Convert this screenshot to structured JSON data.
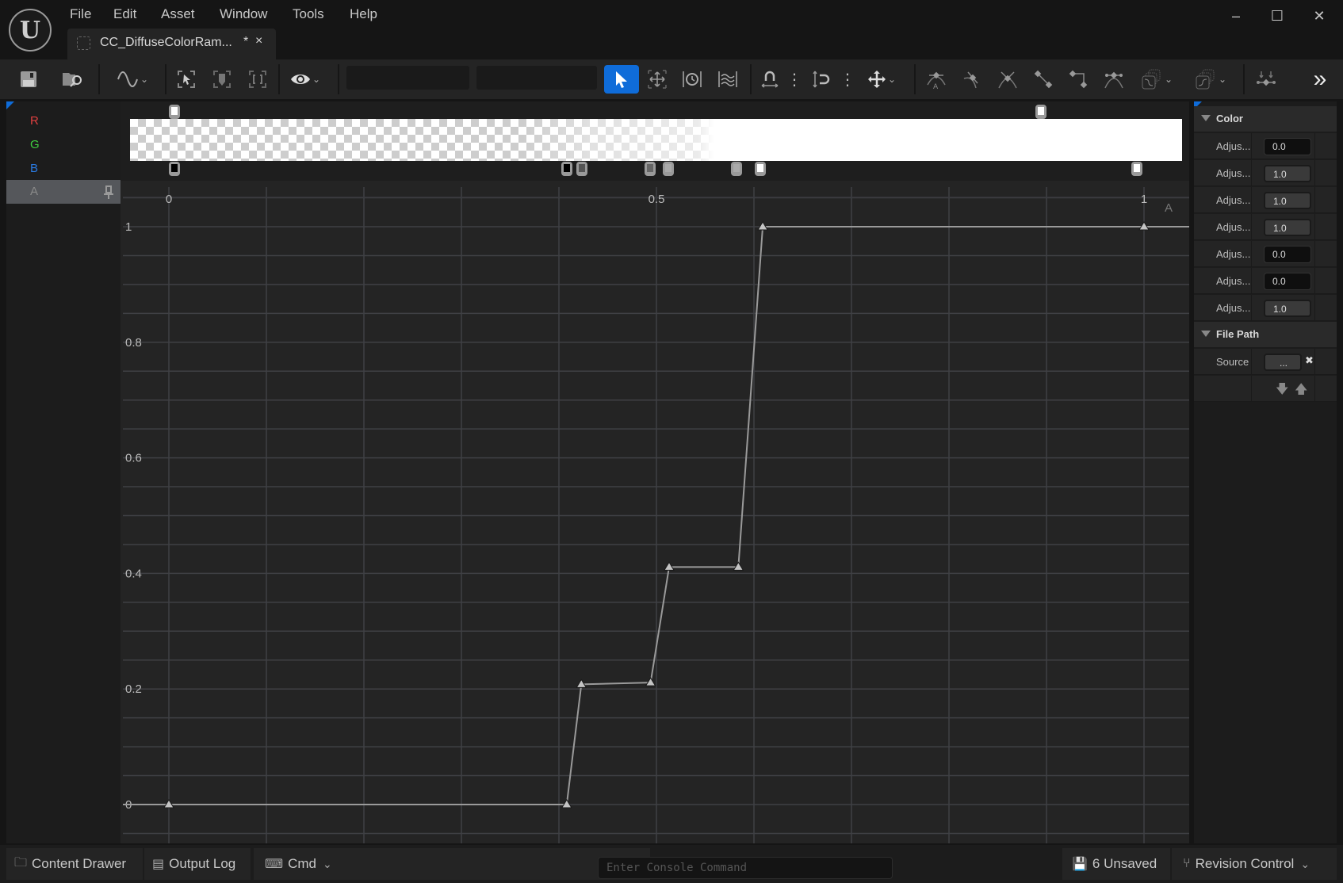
{
  "app": {
    "logo": "unreal-engine-logo",
    "menu": [
      "File",
      "Edit",
      "Asset",
      "Window",
      "Tools",
      "Help"
    ],
    "tab": {
      "label": "CC_DiffuseColorRam...",
      "modified": "*",
      "close": "×"
    },
    "window_controls": {
      "minimize": "–",
      "maximize": "☐",
      "close": "✕"
    }
  },
  "toolbar": {
    "items": [
      {
        "name": "save-icon",
        "glyph": "💾"
      },
      {
        "name": "browse-asset-icon",
        "glyph": "🗀"
      },
      {
        "name": "curve-view-icon",
        "glyph": "∿"
      },
      {
        "name": "frame-selection-icon",
        "glyph": "⬚"
      },
      {
        "name": "frame-pin-icon",
        "glyph": "⬚"
      },
      {
        "name": "frame-all-icon",
        "glyph": "⬚"
      },
      {
        "name": "visibility-eye-icon",
        "glyph": "👁"
      },
      {
        "name": "select-tool-icon",
        "glyph": "➤"
      },
      {
        "name": "transform-tool-icon",
        "glyph": "✥"
      },
      {
        "name": "retime-tool-icon",
        "glyph": "◷"
      },
      {
        "name": "multi-scale-tool-icon",
        "glyph": "≋"
      },
      {
        "name": "snap-time-icon",
        "glyph": "⏚"
      },
      {
        "name": "snap-value-icon",
        "glyph": "⊐"
      },
      {
        "name": "axis-snap-icon",
        "glyph": "✥"
      },
      {
        "name": "tangent-auto-icon",
        "glyph": "⌒"
      },
      {
        "name": "tangent-user-icon",
        "glyph": "⌒"
      },
      {
        "name": "tangent-break-icon",
        "glyph": "⋎"
      },
      {
        "name": "interp-linear-icon",
        "glyph": "⟍"
      },
      {
        "name": "interp-constant-icon",
        "glyph": "⌐"
      },
      {
        "name": "tangent-weighted-icon",
        "glyph": "⌒"
      },
      {
        "name": "pre-infinity-icon",
        "glyph": "⧉"
      },
      {
        "name": "post-infinity-icon",
        "glyph": "⧉"
      },
      {
        "name": "flatten-tangents-icon",
        "glyph": "⋯"
      },
      {
        "name": "more-icon",
        "glyph": "»"
      }
    ],
    "active_tool": "select-tool-icon"
  },
  "channels": [
    {
      "label": "R",
      "color": "#e04040"
    },
    {
      "label": "G",
      "color": "#3fcf3f"
    },
    {
      "label": "B",
      "color": "#2a7ae0"
    },
    {
      "label": "A",
      "color": "#8a8a8a",
      "selected": true
    }
  ],
  "gradient": {
    "alpha_stops_top": [
      0.0,
      0.9
    ],
    "color_stops_bottom": [
      {
        "pos": 0.0,
        "value": "#000000"
      },
      {
        "pos": 0.408,
        "value": "#000000"
      },
      {
        "pos": 0.423,
        "value": "#555555"
      },
      {
        "pos": 0.494,
        "value": "#666666"
      },
      {
        "pos": 0.513,
        "value": "#aaaaaa"
      },
      {
        "pos": 0.584,
        "value": "#aaaaaa"
      },
      {
        "pos": 0.609,
        "value": "#ffffff"
      },
      {
        "pos": 1.0,
        "value": "#ffffff"
      }
    ]
  },
  "chart_data": {
    "type": "line",
    "title": "",
    "series": [
      {
        "name": "A",
        "x": [
          0.0,
          0.408,
          0.423,
          0.494,
          0.513,
          0.584,
          0.609,
          1.0
        ],
        "values": [
          0.0,
          0.0,
          0.208,
          0.211,
          0.411,
          0.411,
          1.0,
          1.0
        ]
      }
    ],
    "xlabel": "",
    "ylabel": "",
    "x_tick_labels": [
      "0",
      "0.5",
      "1"
    ],
    "x_ticks": [
      0,
      0.5,
      1
    ],
    "y_tick_labels": [
      "0",
      "0.2",
      "0.4",
      "0.6",
      "0.8",
      "1"
    ],
    "y_ticks": [
      0,
      0.2,
      0.4,
      0.6,
      0.8,
      1
    ],
    "x_grid_step": 0.1,
    "y_grid_step": 0.05,
    "xlim": [
      -0.05,
      1.05
    ],
    "ylim": [
      -0.06,
      1.06
    ],
    "curve_label": "A",
    "grid": true
  },
  "details": {
    "sections": [
      {
        "title": "Color",
        "rows": [
          {
            "label": "Adjus...",
            "value": "0.0",
            "highlight": false
          },
          {
            "label": "Adjus...",
            "value": "1.0",
            "highlight": true
          },
          {
            "label": "Adjus...",
            "value": "1.0",
            "highlight": true
          },
          {
            "label": "Adjus...",
            "value": "1.0",
            "highlight": true
          },
          {
            "label": "Adjus...",
            "value": "0.0",
            "highlight": false
          },
          {
            "label": "Adjus...",
            "value": "0.0",
            "highlight": false
          },
          {
            "label": "Adjus...",
            "value": "1.0",
            "highlight": true
          }
        ]
      },
      {
        "title": "File Path",
        "rows": [
          {
            "label": "Source",
            "value": "..."
          }
        ]
      }
    ]
  },
  "statusbar": {
    "content_drawer": "Content Drawer",
    "output_log": "Output Log",
    "cmd": "Cmd",
    "console_placeholder": "Enter Console Command",
    "unsaved": "6 Unsaved",
    "revision_control": "Revision Control"
  }
}
